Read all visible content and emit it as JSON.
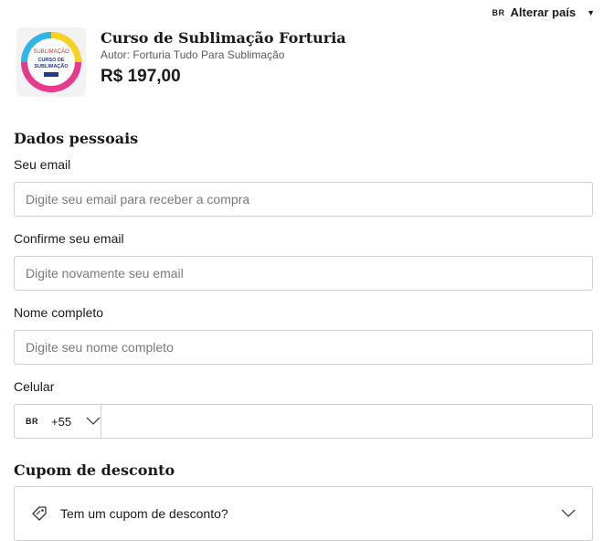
{
  "country_bar": {
    "flag": "BR",
    "label": "Alterar país"
  },
  "product": {
    "thumb_top": "SUBLIMAÇÃO",
    "thumb_line1": "CURSO DE",
    "thumb_line2": "SUBLIMAÇÃO",
    "title": "Curso de Sublimação Forturia",
    "author": "Autor: Forturia Tudo Para Sublimação",
    "price": "R$ 197,00"
  },
  "personal": {
    "title": "Dados pessoais",
    "email_label": "Seu email",
    "email_placeholder": "Digite seu email para receber a compra",
    "confirm_label": "Confirme seu email",
    "confirm_placeholder": "Digite novamente seu email",
    "name_label": "Nome completo",
    "name_placeholder": "Digite seu nome completo",
    "phone_label": "Celular",
    "phone_flag": "BR",
    "phone_code": "+55"
  },
  "coupon": {
    "title": "Cupom de desconto",
    "toggle_label": "Tem um cupom de desconto?"
  },
  "colors": {
    "border": "#cfcfcf",
    "placeholder": "#7a7a7a",
    "text": "#1a1a1a"
  }
}
